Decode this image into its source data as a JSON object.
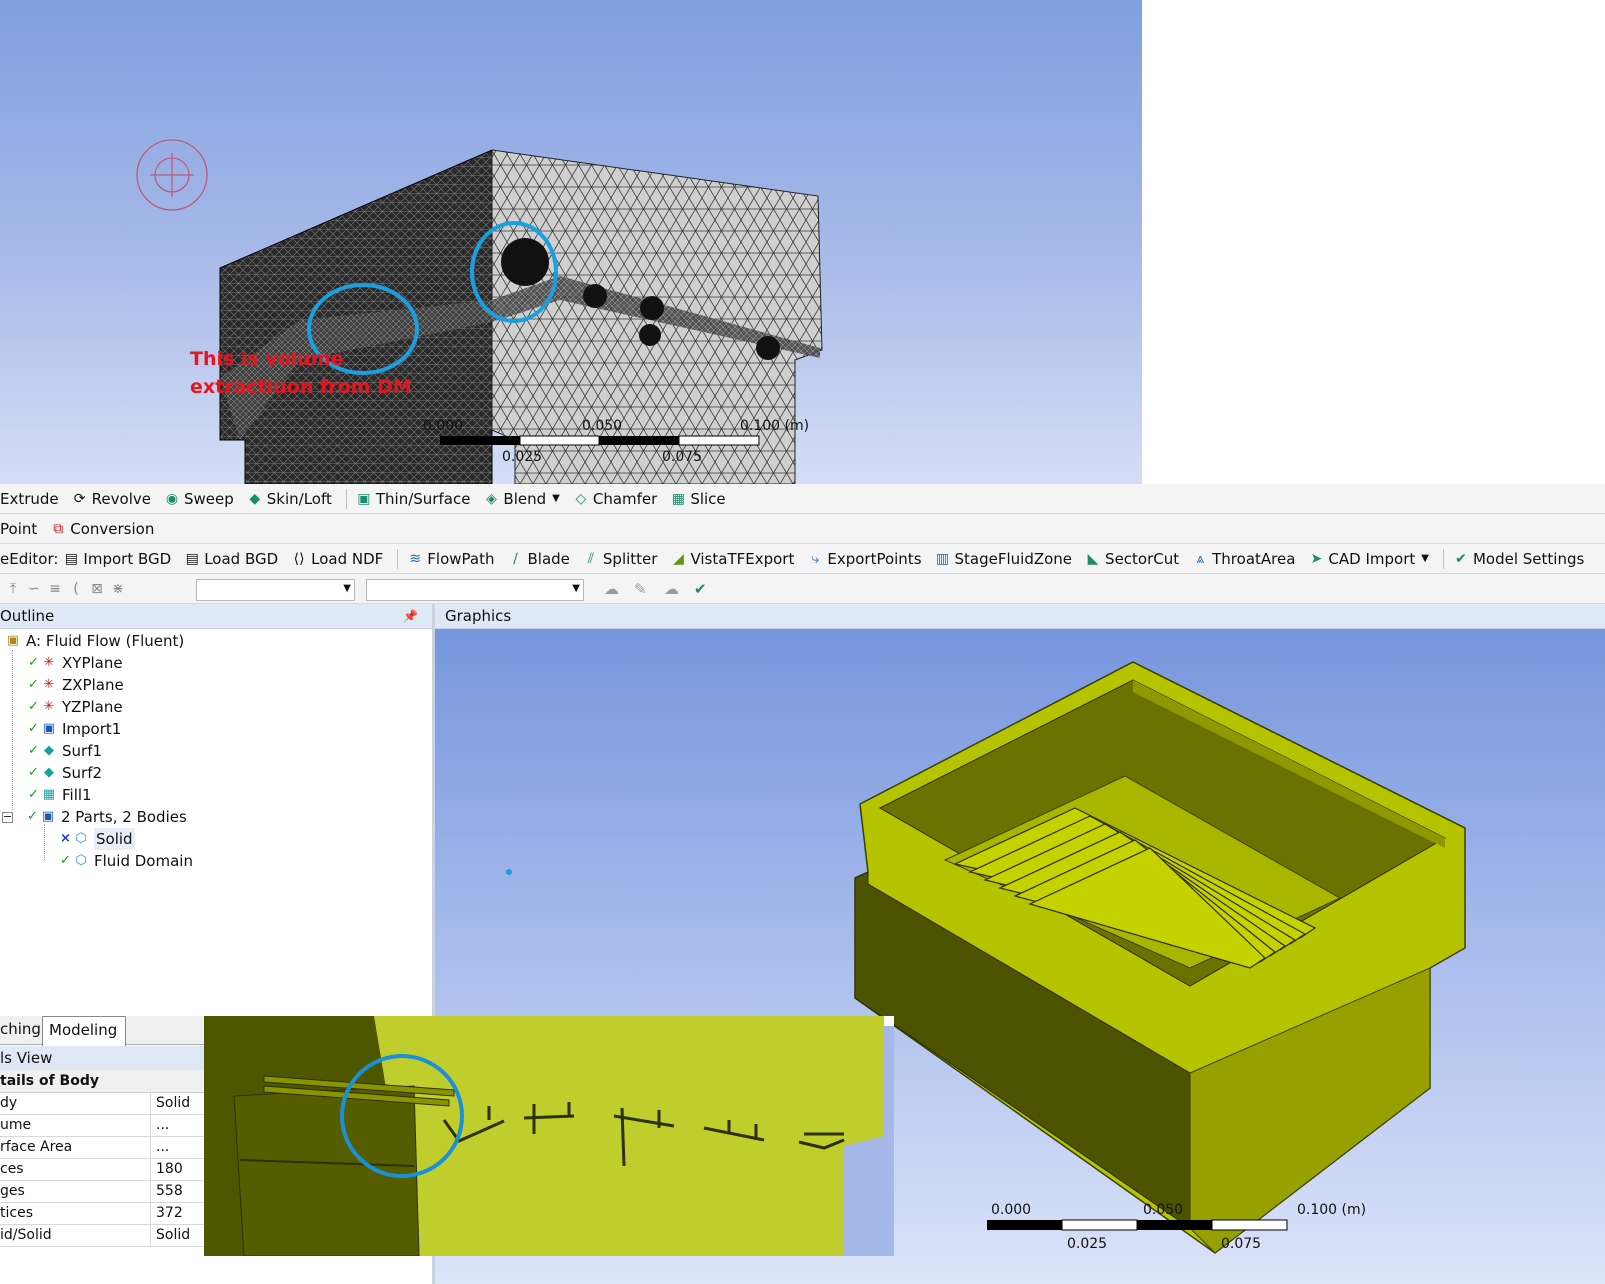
{
  "mesh_view": {
    "annotation": "This is volume extractiuon from DM",
    "annotation_line1": "This is volume",
    "annotation_line2": "extractiuon from DM",
    "scale_top": [
      "0.000",
      "0.050",
      "0.100 (m)"
    ],
    "scale_bottom": [
      "0.025",
      "0.075"
    ]
  },
  "toolbar1": {
    "items": [
      "Extrude",
      "Revolve",
      "Sweep",
      "Skin/Loft",
      "Thin/Surface",
      "Blend",
      "Chamfer",
      "Slice"
    ]
  },
  "toolbar2": {
    "items": [
      "Point",
      "Conversion"
    ]
  },
  "toolbar3": {
    "prefix": "eEditor:",
    "items": [
      "Import BGD",
      "Load BGD",
      "Load NDF",
      "FlowPath",
      "Blade",
      "Splitter",
      "VistaTFExport",
      "ExportPoints",
      "StageFluidZone",
      "SectorCut",
      "ThroatArea",
      "CAD Import",
      "Model Settings"
    ]
  },
  "outline": {
    "title": "Outline",
    "root": "A: Fluid Flow (Fluent)",
    "items": [
      "XYPlane",
      "ZXPlane",
      "YZPlane",
      "Import1",
      "Surf1",
      "Surf2",
      "Fill1",
      "2 Parts, 2 Bodies",
      "Solid",
      "Fluid Domain"
    ]
  },
  "tabs": [
    "ching",
    "Modeling"
  ],
  "details": {
    "view_title": "ls View",
    "header": "tails of Body",
    "rows": [
      {
        "name": "dy",
        "value": "Solid"
      },
      {
        "name": "ume",
        "value": "..."
      },
      {
        "name": "rface Area",
        "value": "..."
      },
      {
        "name": "ces",
        "value": "180"
      },
      {
        "name": "ges",
        "value": "558"
      },
      {
        "name": "tices",
        "value": "372"
      },
      {
        "name": "id/Solid",
        "value": "Solid"
      }
    ]
  },
  "graphics": {
    "title": "Graphics",
    "scale_top": [
      "0.000",
      "0.050",
      "0.100 (m)"
    ],
    "scale_bottom": [
      "0.025",
      "0.075"
    ]
  },
  "colors": {
    "model_green": "#b5c300",
    "model_dark": "#4d5300",
    "annotation_circle": "#1aa0e0",
    "annotation_text": "#e8151f"
  }
}
